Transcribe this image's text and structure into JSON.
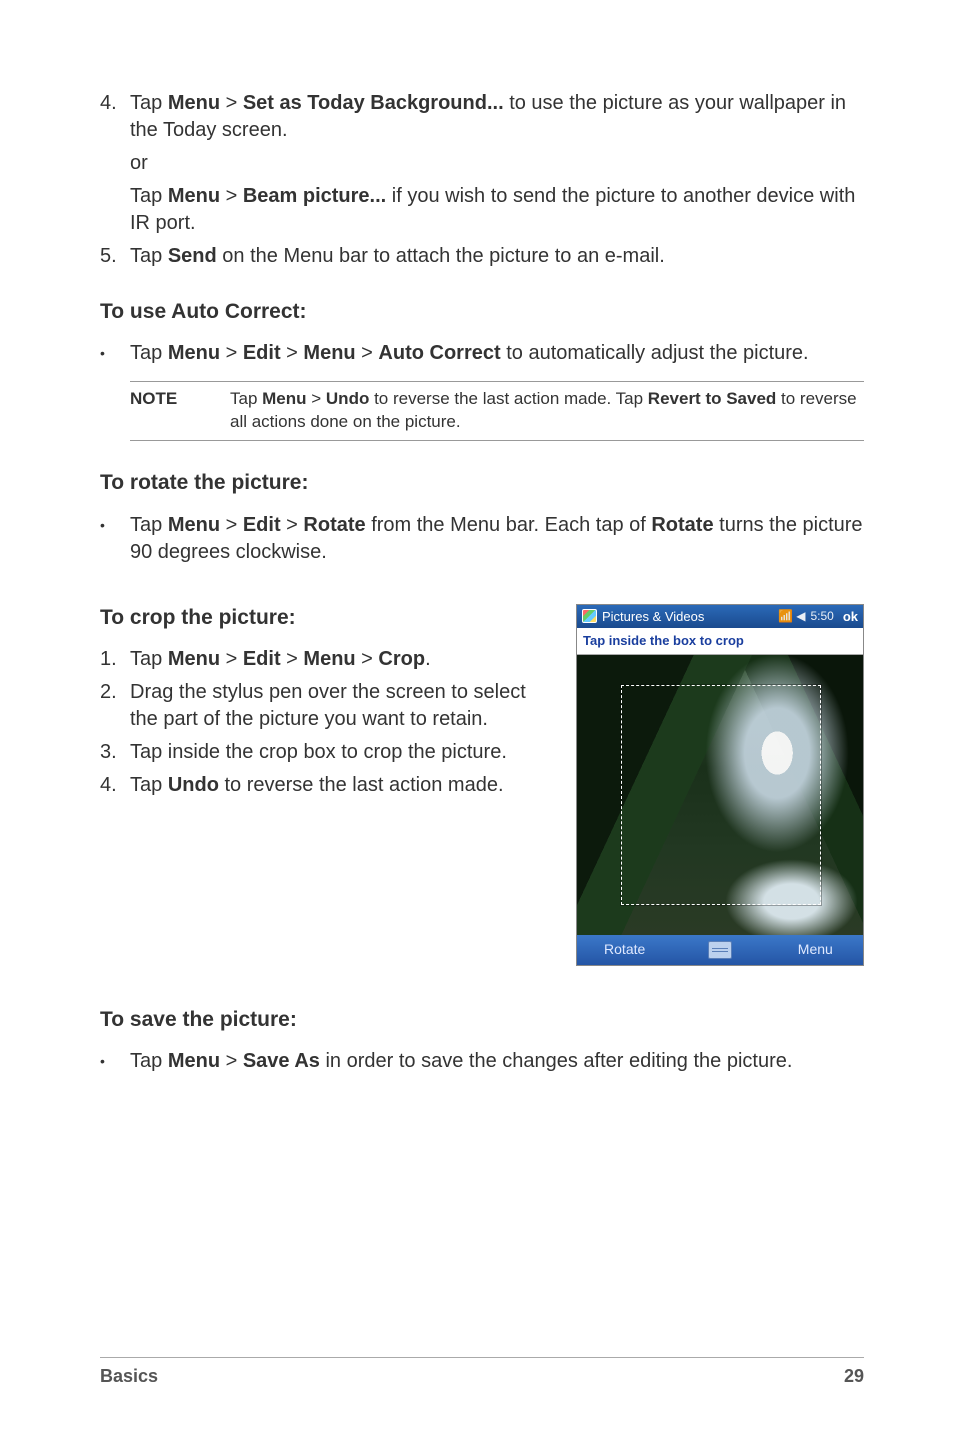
{
  "step4_num": "4.",
  "step4_a": "Tap ",
  "step4_menu": "Menu",
  "step4_gt": " > ",
  "step4_set": "Set as Today Background...",
  "step4_b": " to use the picture as your wallpaper in the Today screen.",
  "step4_or": "or",
  "step4_c": "Tap ",
  "step4_beam": "Beam picture...",
  "step4_d": " if you wish to send the picture to another device with IR port.",
  "step5_num": "5.",
  "step5_a": "Tap ",
  "step5_send": "Send",
  "step5_b": " on the Menu bar to attach the picture to an e-mail.",
  "h_auto": "To use Auto Correct:",
  "bullet": "•",
  "auto_a": "Tap ",
  "auto_menu": "Menu",
  "gt": " > ",
  "auto_edit": "Edit",
  "auto_menu2": "Menu",
  "auto_ac": "Auto Correct",
  "auto_b": " to automatically adjust the picture.",
  "note_label": "NOTE",
  "note_a": "Tap ",
  "note_menu": "Menu",
  "note_undo": "Undo",
  "note_b": " to reverse the last action made. Tap ",
  "note_revert": "Revert to Saved",
  "note_c": " to reverse all actions done on the picture.",
  "h_rotate": "To rotate the picture:",
  "rot_a": "Tap ",
  "rot_menu": "Menu",
  "rot_edit": "Edit",
  "rot_rotate": "Rotate",
  "rot_b": " from the Menu bar. Each tap of ",
  "rot_rotate2": "Rotate",
  "rot_c": " turns the picture 90 degrees clockwise.",
  "h_crop": "To crop the picture:",
  "c1_num": "1.",
  "c1_a": "Tap ",
  "c1_menu": "Menu",
  "c1_edit": "Edit",
  "c1_menu2": "Menu",
  "c1_crop": "Crop",
  "c1_dot": ".",
  "c2_num": "2.",
  "c2": "Drag the stylus pen over the screen to select the part of the picture you want to retain.",
  "c3_num": "3.",
  "c3": "Tap inside the crop box to crop the picture.",
  "c4_num": "4.",
  "c4_a": "Tap ",
  "c4_undo": "Undo",
  "c4_b": " to reverse the last action made.",
  "h_save": "To save the picture:",
  "save_a": "Tap ",
  "save_menu": "Menu",
  "save_as": "Save As",
  "save_b": " in order to save the changes after editing the picture.",
  "ss_title": "Pictures & Videos",
  "ss_status": "5:50",
  "ss_ok": "ok",
  "ss_prompt": "Tap inside the box to crop",
  "ss_rotate": "Rotate",
  "ss_menu": "Menu",
  "footer_left": "Basics",
  "footer_right": "29"
}
